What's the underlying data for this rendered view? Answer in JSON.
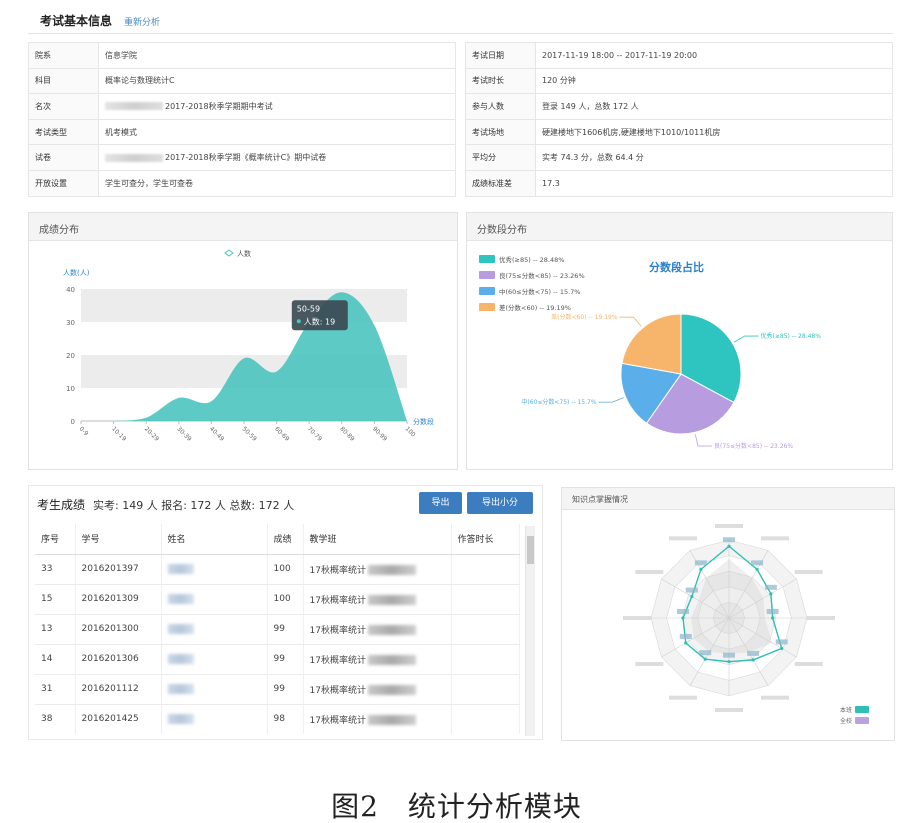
{
  "header": {
    "title": "考试基本信息",
    "link": "重新分析"
  },
  "info_left": [
    {
      "label": "院系",
      "value": "信息学院"
    },
    {
      "label": "科目",
      "value": "概率论与数理统计C"
    },
    {
      "label": "名次",
      "value": "2017-2018秋季学期期中考试"
    },
    {
      "label": "考试类型",
      "value": "机考模式"
    },
    {
      "label": "试卷",
      "value": "2017-2018秋季学期《概率统计C》期中试卷"
    },
    {
      "label": "开放设置",
      "value": "学生可查分，学生可查卷"
    }
  ],
  "info_right": [
    {
      "label": "考试日期",
      "value": "2017-11-19 18:00 -- 2017-11-19 20:00"
    },
    {
      "label": "考试时长",
      "value": "120 分钟"
    },
    {
      "label": "参与人数",
      "value": "登录 149 人，总数 172 人"
    },
    {
      "label": "考试场地",
      "value": "硬建楼地下1606机房,硬建楼地下1010/1011机房"
    },
    {
      "label": "平均分",
      "value": "实考 74.3 分，总数 64.4 分"
    },
    {
      "label": "成绩标准差",
      "value": "17.3"
    }
  ],
  "dist_panel": {
    "title": "成绩分布"
  },
  "pie_panel": {
    "title": "分数段分布"
  },
  "scores_panel": {
    "title": "考生成绩",
    "summary": "实考: 149 人 报名: 172 人 总数: 172 人",
    "export_label": "导出",
    "export_sub_label": "导出小分",
    "columns": [
      "序号",
      "学号",
      "姓名",
      "成绩",
      "教学班",
      "作答时长"
    ],
    "rows": [
      {
        "idx": "33",
        "sid": "2016201397",
        "score": "100",
        "cls": "17秋概率统计"
      },
      {
        "idx": "15",
        "sid": "2016201309",
        "score": "100",
        "cls": "17秋概率统计"
      },
      {
        "idx": "13",
        "sid": "2016201300",
        "score": "99",
        "cls": "17秋概率统计"
      },
      {
        "idx": "14",
        "sid": "2016201306",
        "score": "99",
        "cls": "17秋概率统计"
      },
      {
        "idx": "31",
        "sid": "2016201112",
        "score": "99",
        "cls": "17秋概率统计"
      },
      {
        "idx": "38",
        "sid": "2016201425",
        "score": "98",
        "cls": "17秋概率统计"
      }
    ]
  },
  "radar_panel": {
    "title": "知识点掌握情况"
  },
  "caption": "图2　统计分析模块",
  "chart_data": [
    {
      "type": "area",
      "legend": "人数",
      "ylabel": "人数(人)",
      "xlabel": "分数段",
      "ylim": [
        0,
        40
      ],
      "yticks": [
        0,
        10,
        20,
        30,
        40
      ],
      "categories": [
        "0-9",
        "10-19",
        "20-29",
        "30-39",
        "40-49",
        "50-59",
        "60-69",
        "70-79",
        "80-89",
        "90-99",
        "100"
      ],
      "values": [
        0,
        0,
        1,
        7,
        6,
        19,
        15,
        30,
        39,
        29,
        0
      ],
      "tooltip": {
        "title": "50-59",
        "text": "人数: 19"
      },
      "colors": {
        "fill": "#4cc4c0",
        "grid_band": "#ececec"
      }
    },
    {
      "type": "pie",
      "title": "分数段占比",
      "slices": [
        {
          "name": "优秀(≥85) -- 28.48%",
          "value": 28.48,
          "color": "#2ec5c0"
        },
        {
          "name": "良(75≤分数<85) -- 23.26%",
          "value": 23.26,
          "color": "#b79ce0"
        },
        {
          "name": "中(60≤分数<75) -- 15.7%",
          "value": 15.7,
          "color": "#5aaeea"
        },
        {
          "name": "差(分数<60) -- 19.19%",
          "value": 19.19,
          "color": "#f7b46b"
        }
      ]
    },
    {
      "type": "radar",
      "series": [
        {
          "name": "本班",
          "color": "#2fbfb7"
        },
        {
          "name": "全校",
          "color": "#b9a3e2"
        }
      ],
      "values": [
        0.92,
        0.72,
        0.62,
        0.56,
        0.78,
        0.62,
        0.56,
        0.61,
        0.64,
        0.59,
        0.55,
        0.72
      ]
    }
  ]
}
